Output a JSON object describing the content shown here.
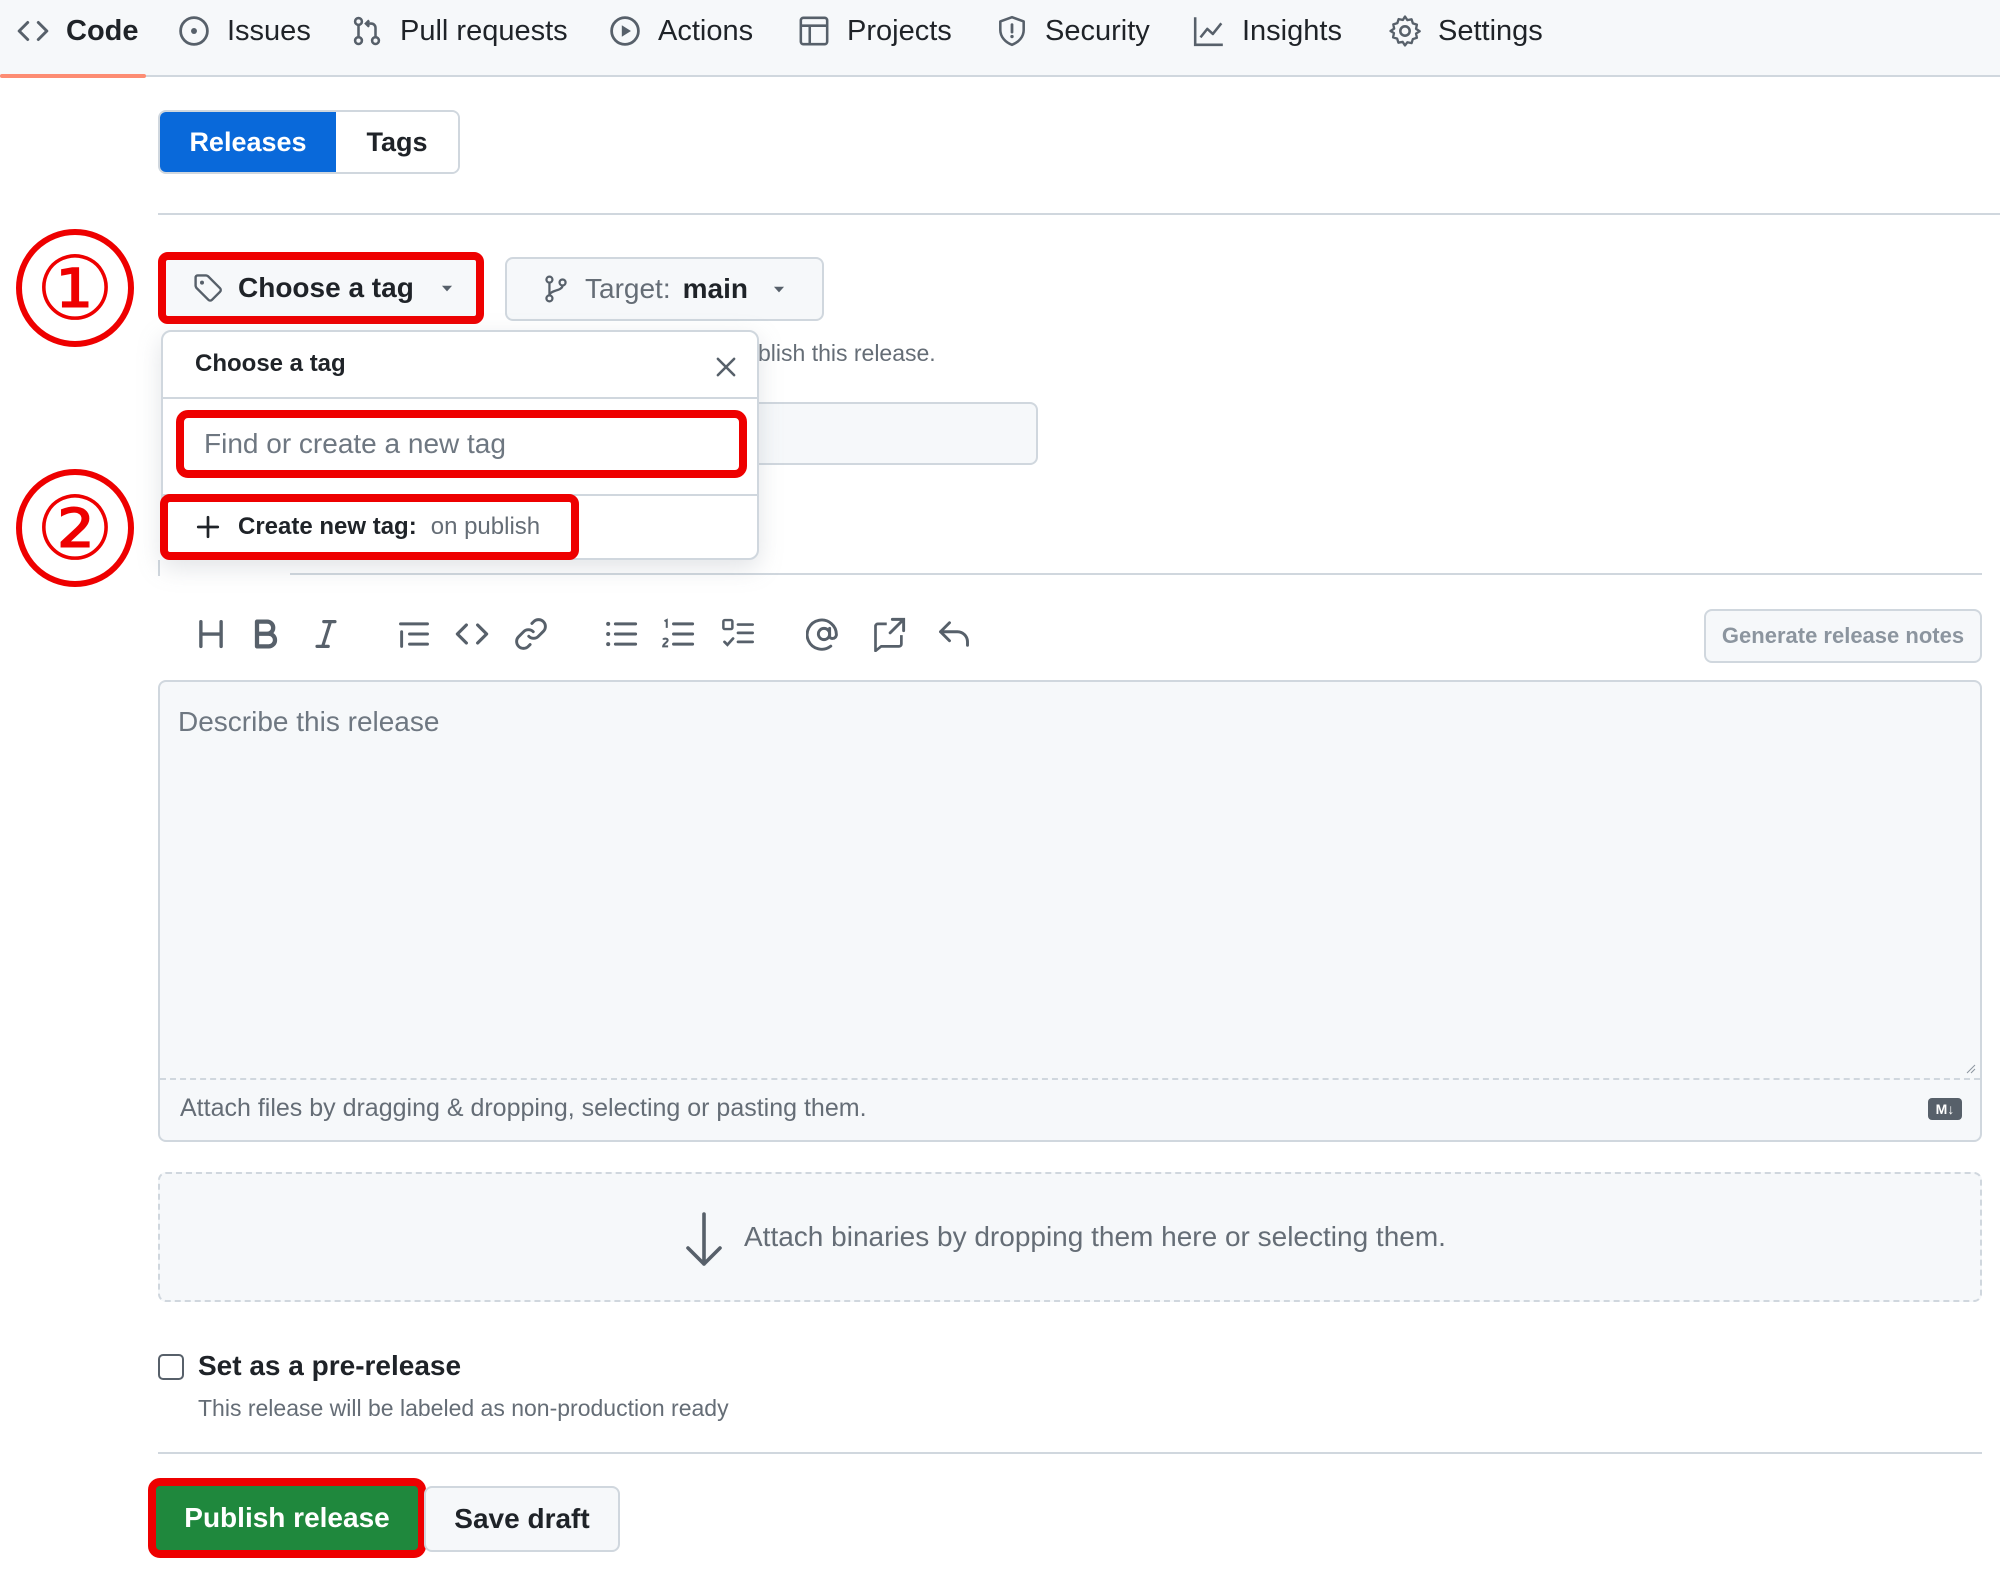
{
  "nav": {
    "items": [
      {
        "label": "Code",
        "icon": "code-icon"
      },
      {
        "label": "Issues",
        "icon": "issue-opened-icon"
      },
      {
        "label": "Pull requests",
        "icon": "git-pull-request-icon"
      },
      {
        "label": "Actions",
        "icon": "play-icon"
      },
      {
        "label": "Projects",
        "icon": "table-icon"
      },
      {
        "label": "Security",
        "icon": "shield-icon"
      },
      {
        "label": "Insights",
        "icon": "graph-icon"
      },
      {
        "label": "Settings",
        "icon": "gear-icon"
      }
    ]
  },
  "tabs": {
    "releases": "Releases",
    "tags": "Tags"
  },
  "tag_button": {
    "label": "Choose a tag"
  },
  "target_button": {
    "prefix": "Target:",
    "branch": "main"
  },
  "hint_text": "blish this release.",
  "popup": {
    "title": "Choose a tag",
    "search_placeholder": "Find or create a new tag",
    "create_label": "Create new tag:",
    "create_suffix": "on publish"
  },
  "annotations": {
    "step1": "①",
    "step2": "②"
  },
  "generate_notes": "Generate release notes",
  "editor": {
    "placeholder": "Describe this release",
    "attach_hint": "Attach files by dragging & dropping, selecting or pasting them.",
    "markdown_badge": "M↓"
  },
  "dropzone_text": "Attach binaries by dropping them here or selecting them.",
  "prerelease": {
    "label": "Set as a pre-release",
    "hint": "This release will be labeled as non-production ready",
    "checked": false
  },
  "actions": {
    "publish": "Publish release",
    "save_draft": "Save draft"
  },
  "colors": {
    "primary": "#0969da",
    "success": "#1f883d",
    "annotation_red": "#ee0000",
    "nav_underline": "#fd8c73"
  }
}
